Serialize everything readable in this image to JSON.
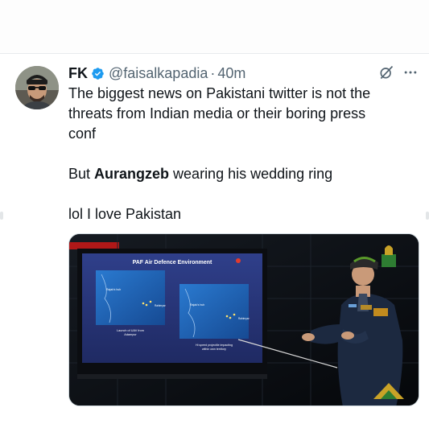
{
  "tweet": {
    "author": {
      "display_name": "FK",
      "handle": "@faisalkapadia",
      "separator": "·",
      "time": "40m",
      "verified": true,
      "avatar_icon": "profile-photo"
    },
    "text": {
      "line1": "The biggest news on Pakistani twitter is not the",
      "line2": "threats from Indian media or their boring press",
      "line3": "conf",
      "para2_before": "But ",
      "para2_bold": "Aurangzeb",
      "para2_after": " wearing his wedding ring",
      "para3": "lol I love Pakistan"
    },
    "actions": {
      "grok_icon": "grok-icon",
      "more_icon": "more-icon"
    }
  },
  "media": {
    "screen_title": "PAF Air Defence Environment",
    "left_map_caption_1": "Launch of UAV from",
    "left_map_caption_2": "Adampur",
    "right_map_caption_1": "Hi speed projectile impacting",
    "right_map_caption_2": "within own territory",
    "left_map_label": "Rajak's hub",
    "right_map_label": "Rajak's hub",
    "map_marker_label": "Rahimyar"
  },
  "colors": {
    "verified": "#1d9bf0",
    "text_primary": "#0f1419",
    "text_secondary": "#536471",
    "screen_bg": "#2a3a7a",
    "map_bg": "#1e5fb0"
  }
}
